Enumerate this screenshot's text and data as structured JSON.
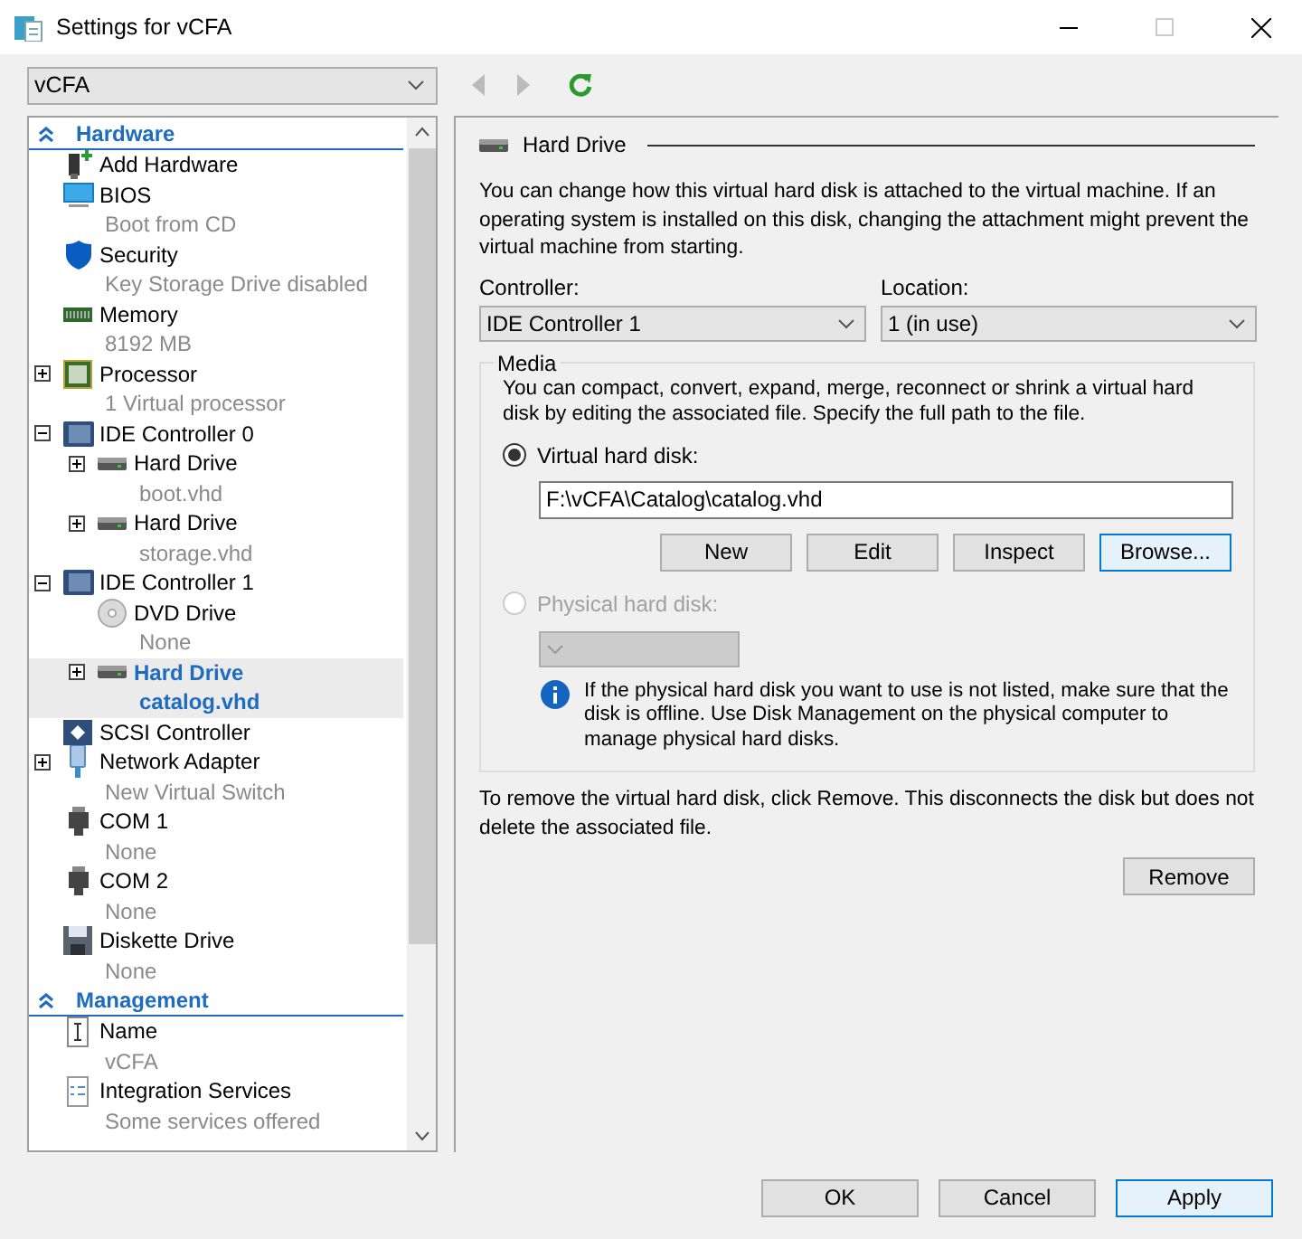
{
  "window": {
    "title": "Settings for vCFA"
  },
  "vm_selector": {
    "value": "vCFA"
  },
  "tree": {
    "sections": [
      {
        "title": "Hardware",
        "expanded": true,
        "items": [
          {
            "kind": "add",
            "name": "Add Hardware"
          },
          {
            "kind": "bios",
            "name": "BIOS",
            "detail": "Boot from CD"
          },
          {
            "kind": "security",
            "name": "Security",
            "detail": "Key Storage Drive disabled"
          },
          {
            "kind": "memory",
            "name": "Memory",
            "detail": "8192 MB"
          },
          {
            "kind": "processor",
            "name": "Processor",
            "detail": "1 Virtual processor",
            "expanded": false
          },
          {
            "kind": "controller",
            "name": "IDE Controller 0",
            "expanded": true,
            "children": [
              {
                "kind": "disk",
                "name": "Hard Drive",
                "detail": "boot.vhd",
                "expanded": false,
                "selected": false
              },
              {
                "kind": "disk",
                "name": "Hard Drive",
                "detail": "storage.vhd",
                "expanded": false,
                "selected": false
              }
            ]
          },
          {
            "kind": "controller",
            "name": "IDE Controller 1",
            "expanded": true,
            "children": [
              {
                "kind": "dvd",
                "name": "DVD Drive",
                "detail": "None",
                "selected": false
              },
              {
                "kind": "disk",
                "name": "Hard Drive",
                "detail": "catalog.vhd",
                "expanded": false,
                "selected": true
              }
            ]
          },
          {
            "kind": "scsi",
            "name": "SCSI Controller"
          },
          {
            "kind": "network",
            "name": "Network Adapter",
            "detail": "New Virtual Switch",
            "expanded": false
          },
          {
            "kind": "com",
            "name": "COM 1",
            "detail": "None"
          },
          {
            "kind": "com",
            "name": "COM 2",
            "detail": "None"
          },
          {
            "kind": "diskette",
            "name": "Diskette Drive",
            "detail": "None"
          }
        ]
      },
      {
        "title": "Management",
        "expanded": true,
        "items": [
          {
            "kind": "name",
            "name": "Name",
            "detail": "vCFA"
          },
          {
            "kind": "services",
            "name": "Integration Services",
            "detail": "Some services offered"
          }
        ]
      }
    ]
  },
  "panel": {
    "title": "Hard Drive",
    "description": "You can change how this virtual hard disk is attached to the virtual machine. If an operating system is installed on this disk, changing the attachment might prevent the virtual machine from starting.",
    "controller": {
      "label": "Controller:",
      "value": "IDE Controller 1"
    },
    "location": {
      "label": "Location:",
      "value": "1 (in use)"
    },
    "media": {
      "title": "Media",
      "description": "You can compact, convert, expand, merge, reconnect or shrink a virtual hard disk by editing the associated file. Specify the full path to the file.",
      "virtual": {
        "label": "Virtual hard disk:",
        "selected": true,
        "path": "F:\\vCFA\\Catalog\\catalog.vhd",
        "buttons": [
          {
            "label": "New",
            "focused": false
          },
          {
            "label": "Edit",
            "focused": false
          },
          {
            "label": "Inspect",
            "focused": false
          },
          {
            "label": "Browse...",
            "focused": true
          }
        ]
      },
      "physical": {
        "label": "Physical hard disk:",
        "selected": false,
        "disabled": true,
        "note": "If the physical hard disk you want to use is not listed, make sure that the disk is offline. Use Disk Management on the physical computer to manage physical hard disks."
      }
    },
    "remove_note": "To remove the virtual hard disk, click Remove. This disconnects the disk but does not delete the associated file.",
    "remove_button": "Remove"
  },
  "buttons": [
    {
      "label": "OK",
      "focused": false
    },
    {
      "label": "Cancel",
      "focused": false
    },
    {
      "label": "Apply",
      "focused": true
    }
  ]
}
